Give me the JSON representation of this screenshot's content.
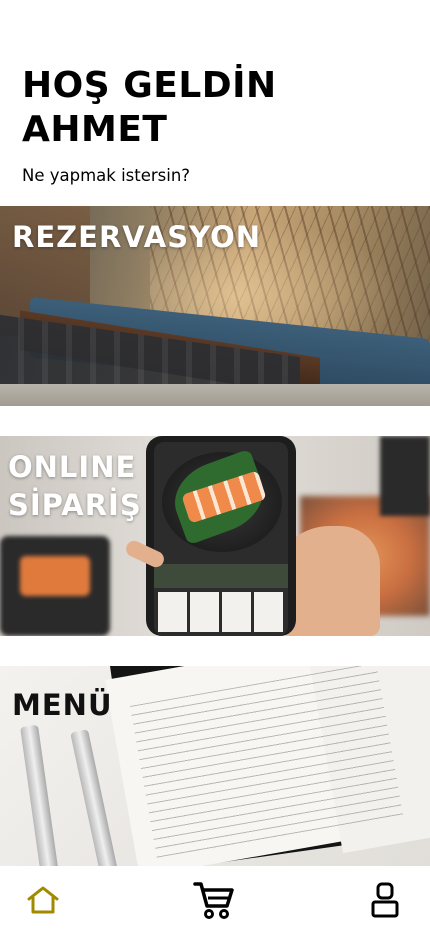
{
  "header": {
    "greeting_line1": "HOŞ GELDİN",
    "greeting_line2": "AHMET",
    "subtitle": "Ne yapmak istersin?"
  },
  "cards": [
    {
      "id": "rezervasyon",
      "title_lines": [
        "REZERVASYON"
      ]
    },
    {
      "id": "online-siparis",
      "title_lines": [
        "ONLINE",
        "SİPARİŞ"
      ]
    },
    {
      "id": "menu",
      "title_lines": [
        "MENÜ"
      ]
    }
  ],
  "bottom_nav": {
    "items": [
      {
        "icon": "home-icon",
        "active": true
      },
      {
        "icon": "cart-icon",
        "active": false
      },
      {
        "icon": "user-icon",
        "active": false
      }
    ]
  },
  "colors": {
    "accent": "#A08A00",
    "text": "#000000",
    "background": "#FFFFFF",
    "card_title": "#FFFFFF"
  }
}
